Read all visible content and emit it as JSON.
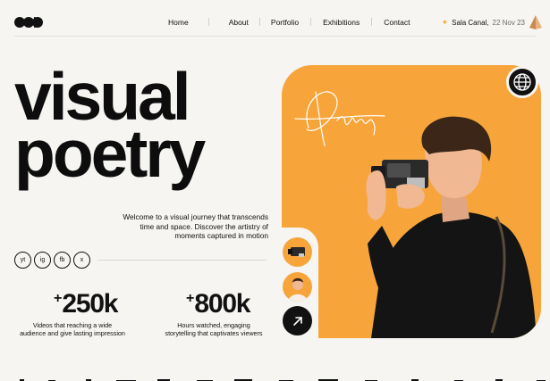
{
  "header": {
    "logo_icon": "brand-circles-logo",
    "nav": [
      "Home",
      "About",
      "Portfolio",
      "Exhibitions",
      "Contact"
    ],
    "event_venue": "Sala Canal,",
    "event_date": "22 Nov 23",
    "event_icon": "pyramid-icon"
  },
  "hero": {
    "headline_line1": "visual",
    "headline_line2": "poetry",
    "intro": "Welcome to a visual journey that transcends time and space. Discover the artistry of moments captured in motion",
    "socials": [
      "yt",
      "ig",
      "fb",
      "x"
    ],
    "accent_color": "#f7a53b",
    "signature_icon": "signature-graphic",
    "globe_icon": "globe-icon",
    "arrow_icon": "arrow-up-right-icon"
  },
  "stats": [
    {
      "prefix": "+",
      "value": "250k",
      "desc_line1": "Videos that reaching a wide",
      "desc_line2": "audience and give lasting impression"
    },
    {
      "prefix": "+",
      "value": "800k",
      "desc_line1": "Hours watched, engaging",
      "desc_line2": "storytelling that captivates viewers"
    }
  ]
}
